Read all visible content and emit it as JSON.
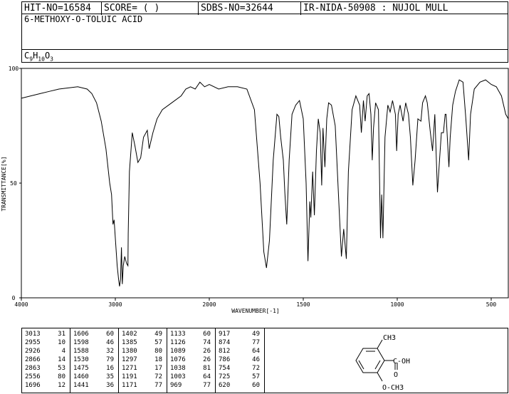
{
  "header": {
    "hit_no": "HIT-NO=16584",
    "score": "SCORE=  (   )",
    "sdbs_no": "SDBS-NO=32644",
    "ir_info": "IR-NIDA-50908 : NUJOL MULL"
  },
  "compound": {
    "name": "6-METHOXY-O-TOLUIC ACID",
    "formula_prefix": "C",
    "formula_c": "9",
    "formula_h_prefix": "H",
    "formula_h": "10",
    "formula_o_prefix": "O",
    "formula_o": "3"
  },
  "chart_data": {
    "type": "line",
    "xlabel": "WAVENUMBER[-1]",
    "ylabel": "TRANSMITTANCE[%]",
    "xlim": [
      4000,
      400
    ],
    "ylim": [
      0,
      100
    ],
    "x_ticks": [
      "4000",
      "3000",
      "2000",
      "1500",
      "1000",
      "500"
    ],
    "y_ticks": [
      "100",
      "50",
      "0"
    ],
    "series": [
      {
        "points": [
          [
            4000,
            87
          ],
          [
            3900,
            88
          ],
          [
            3800,
            89
          ],
          [
            3700,
            90
          ],
          [
            3600,
            91
          ],
          [
            3500,
            91.5
          ],
          [
            3400,
            92
          ],
          [
            3300,
            91
          ],
          [
            3250,
            89
          ],
          [
            3200,
            85
          ],
          [
            3150,
            77
          ],
          [
            3100,
            65
          ],
          [
            3060,
            50
          ],
          [
            3040,
            45
          ],
          [
            3025,
            32
          ],
          [
            3013,
            34
          ],
          [
            3000,
            26
          ],
          [
            2980,
            14
          ],
          [
            2965,
            8
          ],
          [
            2955,
            5
          ],
          [
            2945,
            8
          ],
          [
            2935,
            22
          ],
          [
            2926,
            6
          ],
          [
            2915,
            14
          ],
          [
            2900,
            18
          ],
          [
            2880,
            15
          ],
          [
            2866,
            14
          ],
          [
            2863,
            28
          ],
          [
            2850,
            55
          ],
          [
            2820,
            72
          ],
          [
            2790,
            66
          ],
          [
            2760,
            59
          ],
          [
            2730,
            61
          ],
          [
            2700,
            70
          ],
          [
            2660,
            73
          ],
          [
            2640,
            65
          ],
          [
            2600,
            72
          ],
          [
            2556,
            78
          ],
          [
            2500,
            82
          ],
          [
            2400,
            85
          ],
          [
            2300,
            88
          ],
          [
            2250,
            91
          ],
          [
            2200,
            92
          ],
          [
            2150,
            91
          ],
          [
            2100,
            94
          ],
          [
            2050,
            92
          ],
          [
            2000,
            93
          ],
          [
            1950,
            91
          ],
          [
            1900,
            92
          ],
          [
            1850,
            92
          ],
          [
            1800,
            91
          ],
          [
            1760,
            82
          ],
          [
            1730,
            50
          ],
          [
            1710,
            20
          ],
          [
            1696,
            13
          ],
          [
            1680,
            25
          ],
          [
            1660,
            60
          ],
          [
            1640,
            80
          ],
          [
            1630,
            79
          ],
          [
            1620,
            70
          ],
          [
            1606,
            60
          ],
          [
            1598,
            46
          ],
          [
            1590,
            35
          ],
          [
            1588,
            32
          ],
          [
            1575,
            60
          ],
          [
            1560,
            80
          ],
          [
            1540,
            84
          ],
          [
            1520,
            86
          ],
          [
            1500,
            78
          ],
          [
            1485,
            50
          ],
          [
            1475,
            16
          ],
          [
            1465,
            42
          ],
          [
            1460,
            35
          ],
          [
            1450,
            55
          ],
          [
            1441,
            36
          ],
          [
            1430,
            64
          ],
          [
            1420,
            78
          ],
          [
            1410,
            72
          ],
          [
            1402,
            49
          ],
          [
            1395,
            74
          ],
          [
            1385,
            57
          ],
          [
            1375,
            78
          ],
          [
            1365,
            85
          ],
          [
            1350,
            84
          ],
          [
            1330,
            75
          ],
          [
            1310,
            40
          ],
          [
            1297,
            18
          ],
          [
            1285,
            30
          ],
          [
            1271,
            17
          ],
          [
            1260,
            55
          ],
          [
            1240,
            82
          ],
          [
            1220,
            88
          ],
          [
            1200,
            84
          ],
          [
            1191,
            72
          ],
          [
            1180,
            86
          ],
          [
            1171,
            77
          ],
          [
            1160,
            88
          ],
          [
            1150,
            89
          ],
          [
            1140,
            80
          ],
          [
            1133,
            60
          ],
          [
            1126,
            74
          ],
          [
            1115,
            85
          ],
          [
            1100,
            82
          ],
          [
            1089,
            26
          ],
          [
            1083,
            45
          ],
          [
            1076,
            26
          ],
          [
            1065,
            70
          ],
          [
            1050,
            84
          ],
          [
            1038,
            81
          ],
          [
            1025,
            86
          ],
          [
            1010,
            80
          ],
          [
            1003,
            64
          ],
          [
            995,
            80
          ],
          [
            985,
            84
          ],
          [
            969,
            77
          ],
          [
            955,
            85
          ],
          [
            940,
            80
          ],
          [
            930,
            70
          ],
          [
            917,
            49
          ],
          [
            905,
            60
          ],
          [
            890,
            78
          ],
          [
            874,
            77
          ],
          [
            865,
            85
          ],
          [
            850,
            88
          ],
          [
            840,
            85
          ],
          [
            825,
            73
          ],
          [
            812,
            64
          ],
          [
            800,
            80
          ],
          [
            786,
            46
          ],
          [
            775,
            60
          ],
          [
            765,
            72
          ],
          [
            754,
            72
          ],
          [
            745,
            80
          ],
          [
            740,
            80
          ],
          [
            725,
            57
          ],
          [
            718,
            70
          ],
          [
            705,
            84
          ],
          [
            690,
            90
          ],
          [
            670,
            95
          ],
          [
            650,
            94
          ],
          [
            635,
            78
          ],
          [
            620,
            60
          ],
          [
            610,
            80
          ],
          [
            590,
            91
          ],
          [
            560,
            94
          ],
          [
            530,
            95
          ],
          [
            500,
            93
          ],
          [
            470,
            92
          ],
          [
            440,
            88
          ],
          [
            415,
            80
          ],
          [
            400,
            78
          ]
        ]
      }
    ],
    "peak_table": [
      [
        [
          "3013",
          "31"
        ],
        [
          "2955",
          "10"
        ],
        [
          "2926",
          "4"
        ],
        [
          "2866",
          "14"
        ],
        [
          "2863",
          "53"
        ],
        [
          "2556",
          "80"
        ],
        [
          "1696",
          "12"
        ]
      ],
      [
        [
          "1606",
          "60"
        ],
        [
          "1598",
          "46"
        ],
        [
          "1588",
          "32"
        ],
        [
          "1530",
          "79"
        ],
        [
          "1475",
          "16"
        ],
        [
          "1460",
          "35"
        ],
        [
          "1441",
          "36"
        ]
      ],
      [
        [
          "1402",
          "49"
        ],
        [
          "1385",
          "57"
        ],
        [
          "1380",
          "80"
        ],
        [
          "1297",
          "18"
        ],
        [
          "1271",
          "17"
        ],
        [
          "1191",
          "72"
        ],
        [
          "1171",
          "77"
        ]
      ],
      [
        [
          "1133",
          "60"
        ],
        [
          "1126",
          "74"
        ],
        [
          "1089",
          "26"
        ],
        [
          "1076",
          "26"
        ],
        [
          "1038",
          "81"
        ],
        [
          "1003",
          "64"
        ],
        [
          "969",
          "77"
        ]
      ],
      [
        [
          "917",
          "49"
        ],
        [
          "874",
          "77"
        ],
        [
          "812",
          "64"
        ],
        [
          "786",
          "46"
        ],
        [
          "754",
          "72"
        ],
        [
          "725",
          "57"
        ],
        [
          "620",
          "60"
        ]
      ]
    ]
  },
  "structure": {
    "top_group": "CH3",
    "acid_group": "C-OH",
    "carbonyl": "O",
    "methoxy": "O-CH3"
  }
}
